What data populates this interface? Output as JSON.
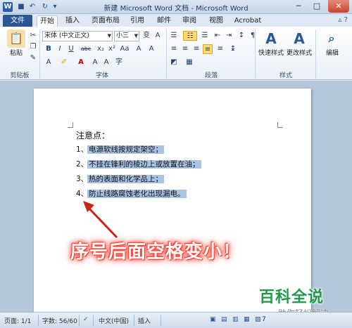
{
  "titlebar": {
    "logo": "W",
    "title": "新建 Microsoft Word 文档 - Microsoft Word",
    "minimize": "─",
    "maximize": "□",
    "close": "✕"
  },
  "tabs": {
    "file": "文件",
    "items": [
      "开始",
      "插入",
      "页面布局",
      "引用",
      "邮件",
      "审阅",
      "视图",
      "Acrobat"
    ],
    "active_index": 0
  },
  "ribbon": {
    "clipboard": {
      "paste_label": "粘贴",
      "group_label": "剪贴板"
    },
    "font": {
      "font_name": "宋体 (中文正文)",
      "font_size": "小三",
      "group_label": "字体",
      "bold": "B",
      "italic": "I",
      "underline": "U",
      "strike": "abc",
      "subscript": "x₂",
      "superscript": "x²",
      "font_color": "A"
    },
    "paragraph": {
      "group_label": "段落"
    },
    "styles": {
      "quick_styles_label": "快速样式",
      "change_styles_label": "更改样式",
      "group_label": "样式"
    },
    "editing": {
      "label": "编辑"
    }
  },
  "document": {
    "heading": "注意点：",
    "items": [
      {
        "num": "1、",
        "text": "电源软线按规定架空；"
      },
      {
        "num": "2、",
        "text": "不挂在锋利的棱边上或放置在油；"
      },
      {
        "num": "3、",
        "text": "热的表面和化学品上；"
      },
      {
        "num": "4、",
        "text": "防止线路腐蚀老化出现漏电。"
      }
    ]
  },
  "annotation": "序号后面空格变小！",
  "watermark": {
    "title": "百科全说",
    "subtitle": "助你轻松解决"
  },
  "statusbar": {
    "page": "页面: 1/1",
    "words": "字数: 56/60",
    "language": "中文(中国)",
    "mode": "插入",
    "zoom": "7"
  },
  "colors": {
    "selection": "#a9c3e4",
    "file_tab": "#2b5797",
    "annotation_glow": "#ff3b2e",
    "watermark": "#1f9a4a"
  }
}
